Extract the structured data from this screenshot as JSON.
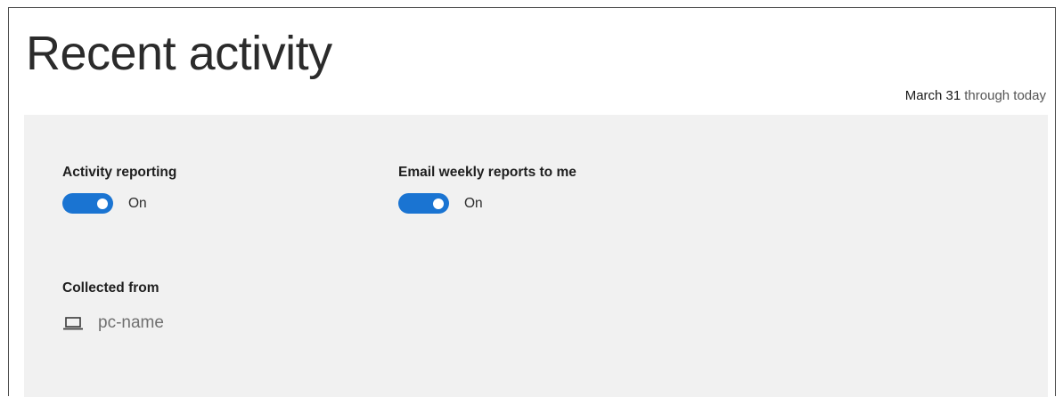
{
  "header": {
    "title": "Recent activity",
    "date_range": {
      "date": "March 31",
      "suffix": "through today"
    }
  },
  "settings": {
    "activity_reporting": {
      "label": "Activity reporting",
      "state": "On",
      "enabled": true
    },
    "email_weekly_reports": {
      "label": "Email weekly reports to me",
      "state": "On",
      "enabled": true
    }
  },
  "collected_from": {
    "label": "Collected from",
    "device_icon": "laptop-icon",
    "device_name": "pc-name"
  },
  "colors": {
    "toggle_on": "#1a74d2",
    "panel_background": "#f1f1f1"
  }
}
